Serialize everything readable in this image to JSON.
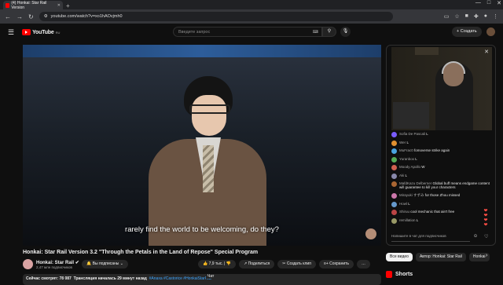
{
  "browser": {
    "tab_title": "(4) Honkai: Star Rail Version",
    "url": "youtube.com/watch?v=xo1hAOvjmh0"
  },
  "youtube": {
    "logo": "YouTube",
    "logo_region": "RU",
    "search_placeholder": "Введите запрос",
    "create_label": "Создать"
  },
  "video": {
    "subtitle": "rarely find the world to be welcoming, do they?",
    "title": "Honkai: Star Rail Version 3.2 \"Through the Petals in the Land of Repose\" Special Program",
    "channel": "Honkai: Star Rail",
    "subscribers": "2,47 млн подписчиков",
    "subscribe_label": "Вы подписаны",
    "likes": "7,9 тыс.",
    "share": "Поделиться",
    "clip": "Создать клип",
    "save": "Сохранить",
    "desc_watching": "Сейчас смотрят: 78 087",
    "desc_started": "Трансляция началась 29 минут назад",
    "desc_tags": "#Anaxa #Castorice #HonkaiStarRail"
  },
  "chat": {
    "label": "Чат",
    "input_placeholder": "Напишите в чат для подписчиков",
    "messages": [
      {
        "author": "Sofia De Pascali",
        "text": "L",
        "color": "#7a5cff"
      },
      {
        "author": "Wer",
        "text": "L",
        "color": "#e09030"
      },
      {
        "author": "MuFrac0",
        "text": "fomoverse strike again",
        "color": "#4aa3df"
      },
      {
        "author": "Yuranbox",
        "text": "L",
        "color": "#55aa55"
      },
      {
        "author": "Moody Apollo",
        "text": "W",
        "color": "#d06050"
      },
      {
        "author": "Aki",
        "text": "L",
        "color": "#8888aa"
      },
      {
        "author": "MafdKazu Delberner",
        "text": "Global buff means endgame content will guarantee to kill your characters",
        "color": "#aa6633"
      },
      {
        "author": "Mirayuki すずみ",
        "text": "for those Zhou missed",
        "color": "#cc77aa"
      },
      {
        "author": "Howl",
        "text": "L",
        "color": "#6699cc"
      },
      {
        "author": "Shiruu",
        "text": "cool mechanic that ain't free",
        "color": "#bb4444"
      },
      {
        "author": "remillation",
        "text": "L",
        "color": "#999966"
      }
    ]
  },
  "recommendations": {
    "chips": [
      "Все видео",
      "Автор: Honkai: Star Rail",
      "Honkai"
    ],
    "shorts": "Shorts"
  }
}
